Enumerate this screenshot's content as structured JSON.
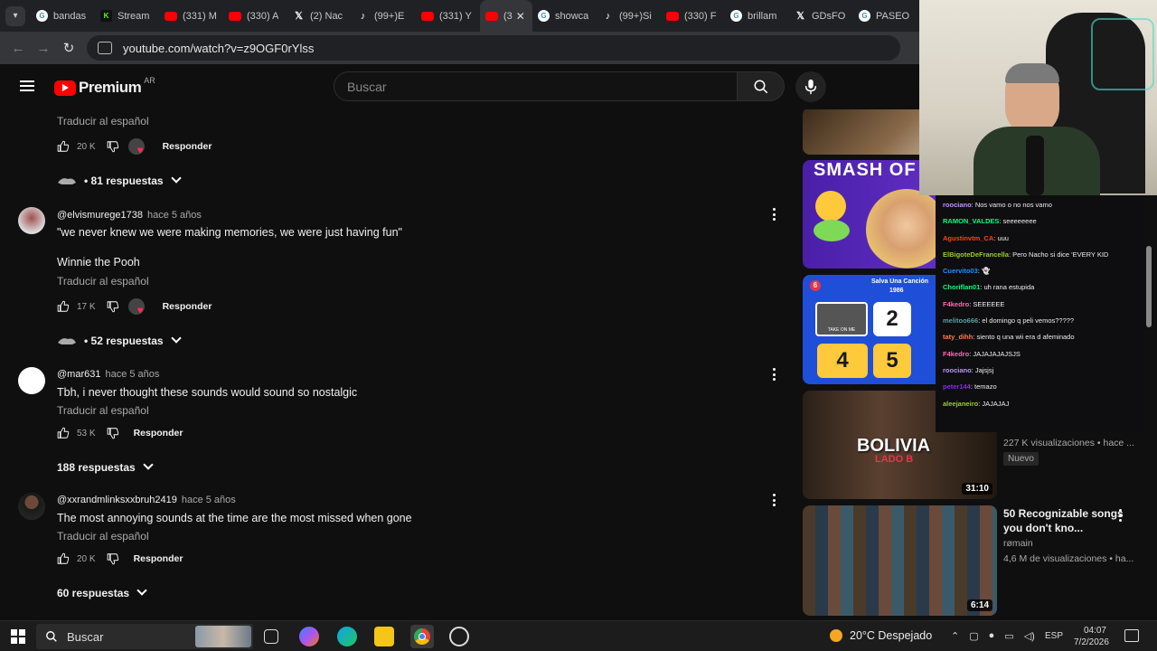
{
  "browser": {
    "tabs": [
      {
        "label": "bandas",
        "icon": "google"
      },
      {
        "label": "Stream",
        "icon": "kick"
      },
      {
        "label": "(331) M",
        "icon": "youtube"
      },
      {
        "label": "(330) A",
        "icon": "youtube"
      },
      {
        "label": "(2) Nac",
        "icon": "x"
      },
      {
        "label": "(99+)E",
        "icon": "tiktok"
      },
      {
        "label": "(331) Y",
        "icon": "youtube"
      },
      {
        "label": "(3",
        "icon": "youtube",
        "active": true
      },
      {
        "label": "showca",
        "icon": "google"
      },
      {
        "label": "(99+)Si",
        "icon": "tiktok"
      },
      {
        "label": "(330) F",
        "icon": "youtube"
      },
      {
        "label": "brillam",
        "icon": "google"
      },
      {
        "label": "GDsFO",
        "icon": "x"
      },
      {
        "label": "PASEO",
        "icon": "google"
      }
    ],
    "url": "youtube.com/watch?v=z9OGF0rYlss"
  },
  "header": {
    "logo_text": "Premium",
    "region": "AR",
    "search_placeholder": "Buscar"
  },
  "comments": [
    {
      "translate": "Traducir al español",
      "likes": "20 K",
      "respond": "Responder",
      "replies": "81 respuestas"
    },
    {
      "author": "@elvismurege1738",
      "time": "hace 5 años",
      "text1": "\"we never knew we were making memories, we were just having fun\"",
      "text2": "Winnie the Pooh",
      "translate": "Traducir al español",
      "likes": "17 K",
      "respond": "Responder",
      "replies": "52 respuestas"
    },
    {
      "author": "@mar631",
      "time": "hace 5 años",
      "text1": "Tbh, i never thought these sounds would sound so nostalgic",
      "translate": "Traducir al español",
      "likes": "53 K",
      "respond": "Responder",
      "replies": "188 respuestas"
    },
    {
      "author": "@xxrandmlinksxxbruh2419",
      "time": "hace 5 años",
      "text1": "The most annoying sounds at the time are the most missed when gone",
      "translate": "Traducir al español",
      "likes": "20 K",
      "respond": "Responder",
      "replies": "60 respuestas"
    }
  ],
  "sidebar": {
    "thumb_smash_text": "SMASH OF",
    "thumb_song": {
      "header": "Salva Una Canción",
      "year": "1986",
      "badge": "6",
      "n1": "2",
      "n2": "4",
      "n3": "5",
      "small": "TAKE ON ME"
    },
    "video_bolivia": {
      "thumb_title": "BOLIVIA",
      "thumb_sub": "LADO B",
      "duration": "31:10",
      "meta": "227 K visualizaciones • hace ...",
      "badge": "Nuevo"
    },
    "video_songs": {
      "title": "50 Recognizable songs you don't kno...",
      "channel": "rømain",
      "meta": "4,6 M de visualizaciones • ha...",
      "duration": "6:14"
    }
  },
  "chat": [
    {
      "user": "roociano",
      "color": "#bf94ff",
      "msg": "Nos vamo o no nos vamo"
    },
    {
      "user": "RAMON_VALDES",
      "color": "#00ff7f",
      "msg": "seeeeeeee"
    },
    {
      "user": "Agustinvtm_CA",
      "color": "#ff4500",
      "msg": "uuu"
    },
    {
      "user": "ElBigoteDeFrancella",
      "color": "#9acd32",
      "msg": "Pero Nacho si dice 'EVERY KID"
    },
    {
      "user": "Cuervito03",
      "color": "#1e90ff",
      "msg": "👻"
    },
    {
      "user": "Choriflan01",
      "color": "#00ff7f",
      "msg": "uh rana estupida"
    },
    {
      "user": "F4kedro",
      "color": "#ff69b4",
      "msg": "SEEEEEE"
    },
    {
      "user": "melitoo666",
      "color": "#5f9ea0",
      "msg": "el domingo q peli vemos?????"
    },
    {
      "user": "taty_dihh",
      "color": "#ff7f50",
      "msg": "siento q una wii era d afeminado"
    },
    {
      "user": "F4kedro",
      "color": "#ff69b4",
      "msg": "JAJAJAJAJSJS"
    },
    {
      "user": "roociano",
      "color": "#bf94ff",
      "msg": "Jajsjsj"
    },
    {
      "user": "peter144",
      "color": "#8a2be2",
      "msg": "temazo"
    },
    {
      "user": "aleejaneiro",
      "color": "#9acd32",
      "msg": "JAJAJAJ"
    }
  ],
  "taskbar": {
    "search": "Buscar",
    "weather": "20°C  Despejado",
    "lang": "ESP",
    "time": "04:07",
    "date": "7/2/2026"
  }
}
